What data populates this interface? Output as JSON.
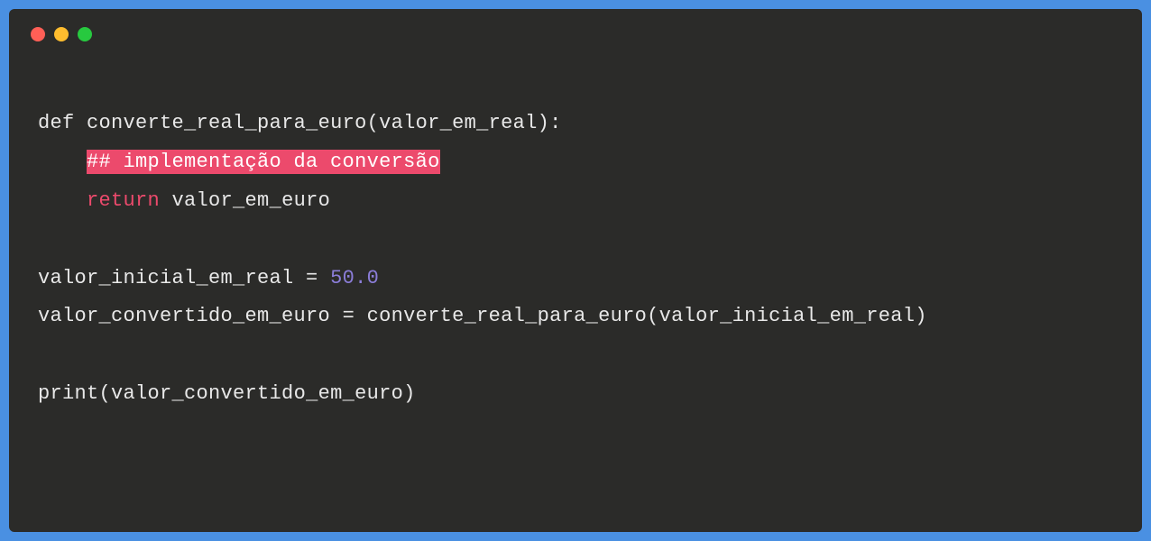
{
  "code": {
    "line1": {
      "def": "def",
      "funcName": "converte_real_para_euro",
      "openParen": "(",
      "param": "valor_em_real",
      "closeParen": ")",
      "colon": ":"
    },
    "line2": {
      "indent": "    ",
      "comment": "## implementação da conversão"
    },
    "line3": {
      "indent": "    ",
      "return": "return",
      "space": " ",
      "variable": "valor_em_euro"
    },
    "line5": {
      "variable": "valor_inicial_em_real",
      "equals": " = ",
      "number": "50.0"
    },
    "line6": {
      "variable": "valor_convertido_em_euro",
      "equals": " = ",
      "funcCall": "converte_real_para_euro",
      "openParen": "(",
      "arg": "valor_inicial_em_real",
      "closeParen": ")"
    },
    "line8": {
      "builtin": "print",
      "openParen": "(",
      "arg": "valor_convertido_em_euro",
      "closeParen": ")"
    }
  }
}
